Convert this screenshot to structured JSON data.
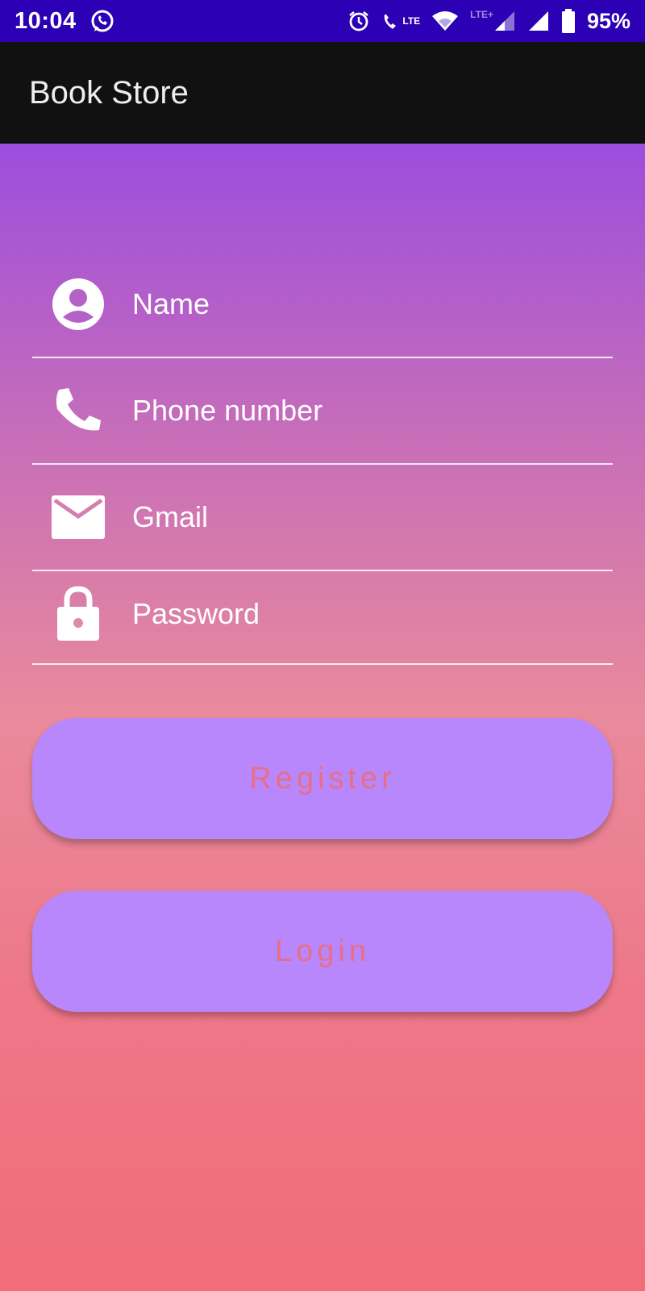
{
  "status_bar": {
    "time": "10:04",
    "battery_percent": "95%",
    "lte_call": "LTE",
    "lte_plus": "LTE+",
    "icons": [
      "whatsapp-icon",
      "alarm-icon",
      "volte-call-icon",
      "wifi-icon",
      "signal-icon",
      "signal-full-icon",
      "battery-icon"
    ]
  },
  "app_bar": {
    "title": "Book Store"
  },
  "form": {
    "name": {
      "placeholder": "Name",
      "value": "",
      "icon": "account-icon"
    },
    "phone": {
      "placeholder": "Phone number",
      "value": "",
      "icon": "phone-icon"
    },
    "gmail": {
      "placeholder": "Gmail",
      "value": "",
      "icon": "mail-icon"
    },
    "password": {
      "placeholder": "Password",
      "value": "",
      "icon": "lock-icon"
    }
  },
  "buttons": {
    "register_label": "Register",
    "login_label": "Login"
  },
  "colors": {
    "status_bar_bg": "#2c00b4",
    "app_bar_bg": "#111111",
    "gradient_top": "#9c4ddd",
    "gradient_bottom": "#f26c79",
    "button_bg": "#b887fc",
    "button_text": "#ea6d87"
  }
}
